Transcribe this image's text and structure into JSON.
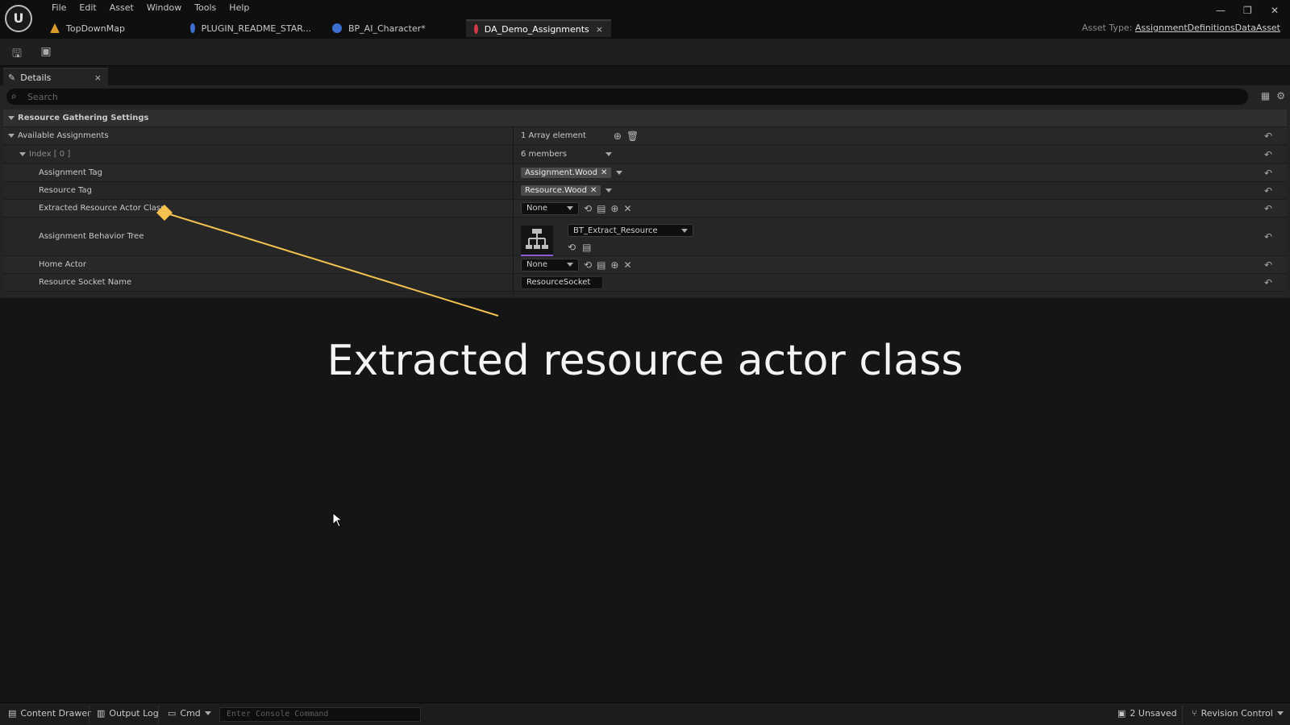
{
  "menu": [
    "File",
    "Edit",
    "Asset",
    "Window",
    "Tools",
    "Help"
  ],
  "tabs": [
    {
      "label": "TopDownMap"
    },
    {
      "label": "PLUGIN_README_STAR..."
    },
    {
      "label": "BP_AI_Character*"
    },
    {
      "label": "DA_Demo_Assignments",
      "close": "×"
    }
  ],
  "asset_type": {
    "label": "Asset Type:",
    "value": "AssignmentDefinitionsDataAsset"
  },
  "details": {
    "tab_label": "Details",
    "close": "×",
    "search_placeholder": "Search"
  },
  "properties": {
    "section": "Resource Gathering Settings",
    "available_assignments": {
      "name": "Available Assignments",
      "value": "1 Array element"
    },
    "index": {
      "name": "Index [ 0 ]",
      "value": "6 members"
    },
    "assignment_tag": {
      "name": "Assignment Tag",
      "value": "Assignment.Wood"
    },
    "resource_tag": {
      "name": "Resource Tag",
      "value": "Resource.Wood"
    },
    "extracted_class": {
      "name": "Extracted Resource Actor Class",
      "value": "None"
    },
    "behavior_tree": {
      "name": "Assignment Behavior Tree",
      "value": "BT_Extract_Resource"
    },
    "home_actor": {
      "name": "Home Actor",
      "value": "None"
    },
    "socket_name": {
      "name": "Resource Socket Name",
      "value": "ResourceSocket"
    }
  },
  "caption": "Extracted resource actor class",
  "statusbar": {
    "content_drawer": "Content Drawer",
    "output_log": "Output Log",
    "cmd": "Cmd",
    "console_placeholder": "Enter Console Command",
    "unsaved": "2 Unsaved",
    "revision": "Revision Control"
  },
  "colors": {
    "accent_highlight": "#f2c14e",
    "bt_underline": "#8b5ad6"
  }
}
